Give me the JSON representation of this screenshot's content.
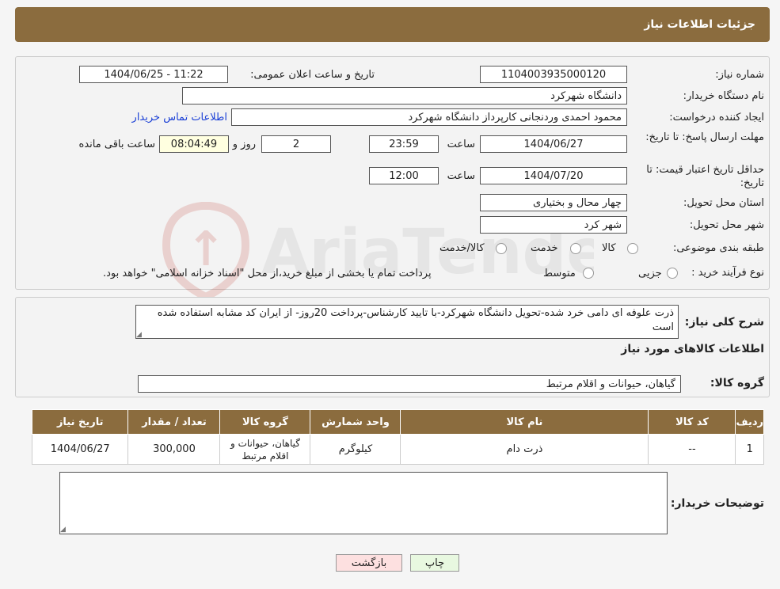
{
  "header": {
    "title": "جزئیات اطلاعات نیاز"
  },
  "form": {
    "need_number_label": "شماره نیاز:",
    "need_number": "1104003935000120",
    "announce_label": "تاریخ و ساعت اعلان عمومی:",
    "announce_value": "1404/06/25 - 11:22",
    "buyer_org_label": "نام دستگاه خریدار:",
    "buyer_org": "دانشگاه شهرکرد",
    "creator_label": "ایجاد کننده درخواست:",
    "creator": "محمود احمدی وردنجانی کارپرداز دانشگاه شهرکرد",
    "contact_link": "اطلاعات تماس خریدار",
    "deadline_label": "مهلت ارسال پاسخ: تا تاریخ:",
    "deadline_date": "1404/06/27",
    "time_label": "ساعت",
    "deadline_time": "23:59",
    "days_value": "2",
    "days_label": "روز و",
    "remaining_time": "08:04:49",
    "remaining_label": "ساعت باقی مانده",
    "validity_label": "حداقل تاریخ اعتبار قیمت: تا تاریخ:",
    "validity_date": "1404/07/20",
    "validity_time": "12:00",
    "province_label": "استان محل تحویل:",
    "province": "چهار محال و بختیاری",
    "city_label": "شهر محل تحویل:",
    "city": "شهر کرد",
    "category_label": "طبقه بندی موضوعی:",
    "category_options": [
      "کالا",
      "خدمت",
      "کالا/خدمت"
    ],
    "process_label": "نوع فرآیند خرید :",
    "process_options": [
      "جزیی",
      "متوسط"
    ],
    "process_note": "پرداخت تمام یا بخشی از مبلغ خرید،از محل \"اسناد خزانه اسلامی\" خواهد بود."
  },
  "watermark": {
    "text": "AriaTender.neT"
  },
  "description": {
    "label": "شرح کلی نیاز:",
    "text": "ذرت علوفه ای دامی خرد شده-تحویل دانشگاه شهرکرد-با تایید کارشناس-پرداخت 20روز- از ایران کد مشابه استفاده شده است"
  },
  "goods": {
    "section_title": "اطلاعات کالاهای مورد نیاز",
    "group_label": "گروه کالا:",
    "group_value": "گیاهان، حیوانات و اقلام مرتبط",
    "columns": [
      "ردیف",
      "کد کالا",
      "نام کالا",
      "واحد شمارش",
      "گروه کالا",
      "تعداد / مقدار",
      "تاریخ نیاز"
    ],
    "rows": [
      [
        "1",
        "--",
        "ذرت دام",
        "کیلوگرم",
        "گیاهان، حیوانات و اقلام مرتبط",
        "300,000",
        "1404/06/27"
      ]
    ]
  },
  "buyer_notes": {
    "label": "توضیحات خریدار:",
    "value": ""
  },
  "buttons": {
    "print": "چاپ",
    "back": "بازگشت"
  },
  "colors": {
    "header_brown": "#8b6c3e",
    "link_blue": "#1a3fd6",
    "back_pink": "#fde0e0",
    "print_green": "#e8f8e0",
    "watermark_red": "#c0392b"
  }
}
